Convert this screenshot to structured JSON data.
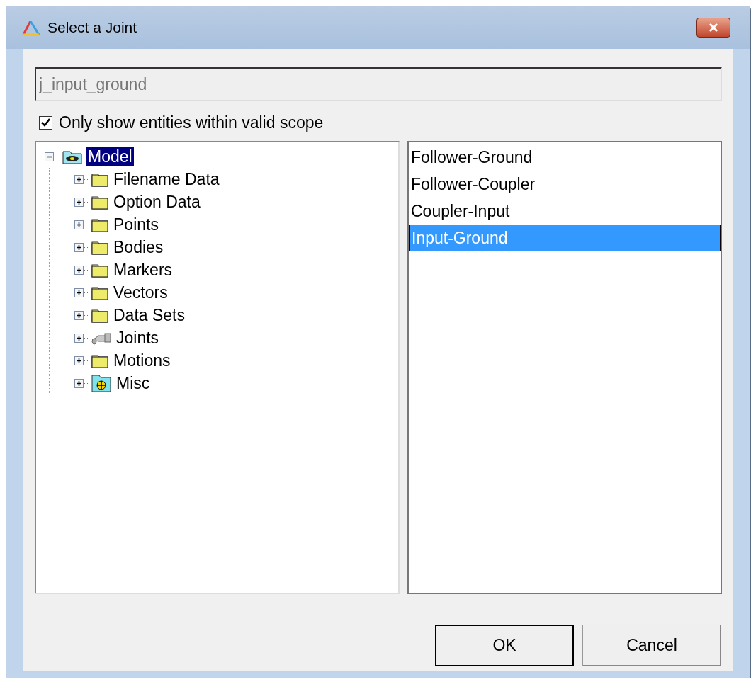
{
  "window": {
    "title": "Select a Joint"
  },
  "name_field": {
    "value": "j_input_ground"
  },
  "scope_checkbox": {
    "label": "Only show entities within valid scope",
    "checked": true
  },
  "tree": [
    {
      "label": "Model",
      "kind": "model",
      "expanded": true,
      "selected": true,
      "children": [
        {
          "label": "Filename Data",
          "kind": "folder",
          "expanded": false,
          "selected": false
        },
        {
          "label": "Option Data",
          "kind": "folder",
          "expanded": false,
          "selected": false
        },
        {
          "label": "Points",
          "kind": "folder",
          "expanded": false,
          "selected": false
        },
        {
          "label": "Bodies",
          "kind": "folder",
          "expanded": false,
          "selected": false
        },
        {
          "label": "Markers",
          "kind": "folder",
          "expanded": false,
          "selected": false
        },
        {
          "label": "Vectors",
          "kind": "folder",
          "expanded": false,
          "selected": false
        },
        {
          "label": "Data Sets",
          "kind": "folder",
          "expanded": false,
          "selected": false
        },
        {
          "label": "Joints",
          "kind": "joint",
          "expanded": false,
          "selected": false
        },
        {
          "label": "Motions",
          "kind": "folder",
          "expanded": false,
          "selected": false
        },
        {
          "label": "Misc",
          "kind": "misc",
          "expanded": false,
          "selected": false
        }
      ]
    }
  ],
  "entities": [
    {
      "label": "Follower-Ground",
      "selected": false
    },
    {
      "label": "Follower-Coupler",
      "selected": false
    },
    {
      "label": "Coupler-Input",
      "selected": false
    },
    {
      "label": "Input-Ground",
      "selected": true
    }
  ],
  "buttons": [
    {
      "label": "OK",
      "default": true
    },
    {
      "label": "Cancel",
      "default": false
    }
  ]
}
